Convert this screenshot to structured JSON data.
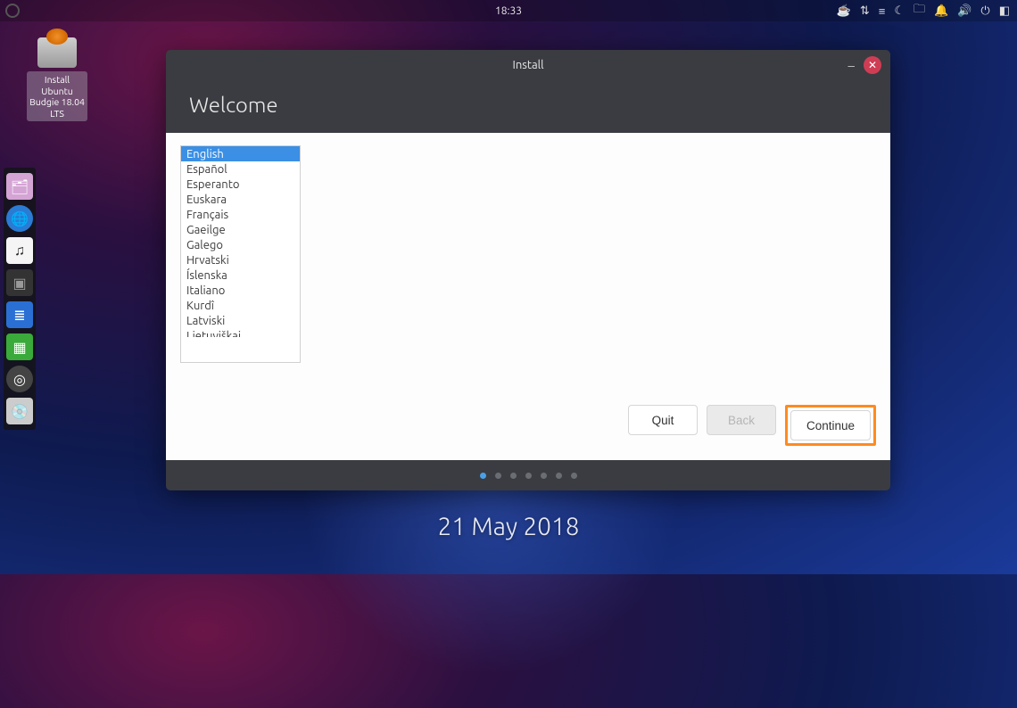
{
  "panel": {
    "clock": "18:33"
  },
  "desktop": {
    "installer_label": "Install Ubuntu Budgie 18.04 LTS",
    "date": "21 May 2018"
  },
  "window": {
    "title": "Install",
    "heading": "Welcome",
    "languages": [
      "English",
      "Español",
      "Esperanto",
      "Euskara",
      "Français",
      "Gaeilge",
      "Galego",
      "Hrvatski",
      "Íslenska",
      "Italiano",
      "Kurdî",
      "Latviski",
      "Lietuviškai"
    ],
    "selected_index": 0,
    "buttons": {
      "quit": "Quit",
      "back": "Back",
      "continue": "Continue"
    },
    "page_count": 7,
    "active_page": 0
  }
}
